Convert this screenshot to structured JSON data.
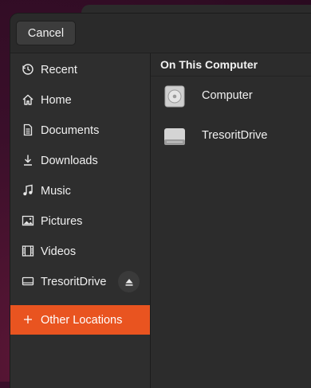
{
  "header": {
    "cancel_label": "Cancel"
  },
  "sidebar": {
    "items": [
      {
        "label": "Recent",
        "icon": "clock-icon"
      },
      {
        "label": "Home",
        "icon": "home-icon"
      },
      {
        "label": "Documents",
        "icon": "document-icon"
      },
      {
        "label": "Downloads",
        "icon": "download-icon"
      },
      {
        "label": "Music",
        "icon": "music-note-icon"
      },
      {
        "label": "Pictures",
        "icon": "picture-icon"
      },
      {
        "label": "Videos",
        "icon": "film-icon"
      },
      {
        "label": "TresoritDrive",
        "icon": "drive-icon",
        "action_icon": "eject-icon"
      }
    ],
    "other_locations": {
      "label": "Other Locations",
      "icon": "plus-icon",
      "selected": true
    }
  },
  "main": {
    "section_title": "On This Computer",
    "locations": [
      {
        "label": "Computer",
        "icon": "disk-icon"
      },
      {
        "label": "TresoritDrive",
        "icon": "drive-icon"
      }
    ]
  },
  "colors": {
    "accent": "#e95420",
    "sidebar_bg": "#2e2e2e",
    "main_bg": "#2c2c2c"
  }
}
